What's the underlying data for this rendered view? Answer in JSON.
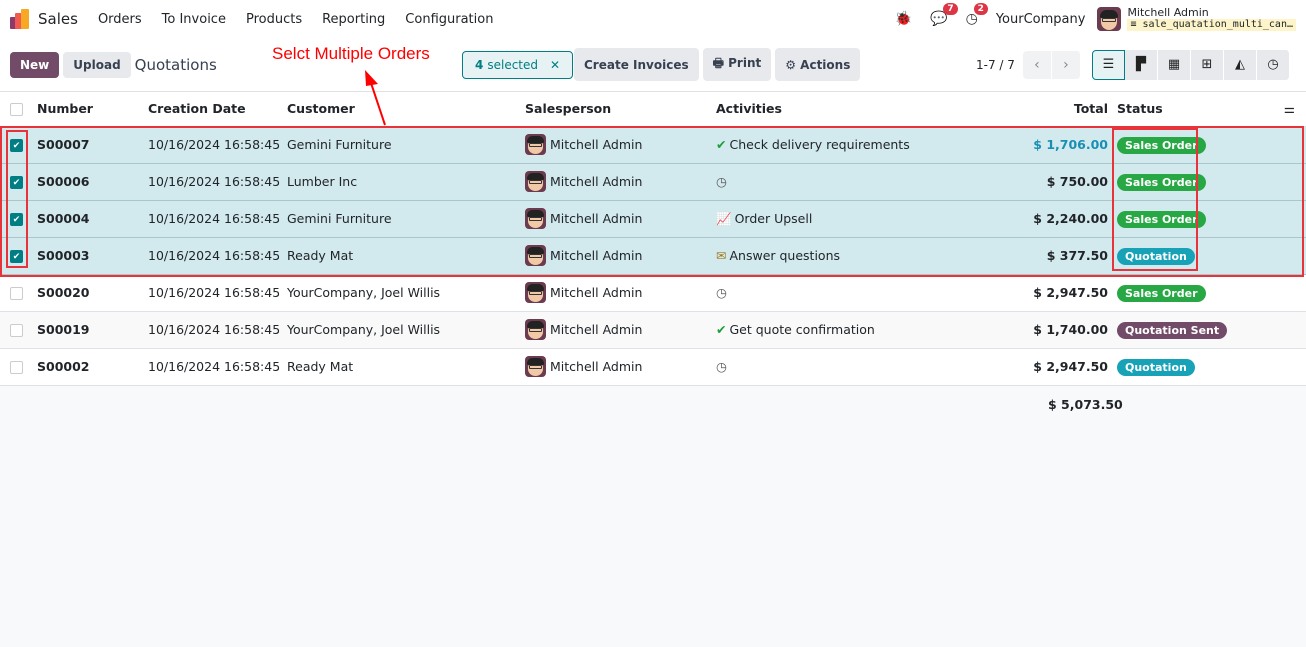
{
  "navbar": {
    "app_name": "Sales",
    "menu": [
      "Orders",
      "To Invoice",
      "Products",
      "Reporting",
      "Configuration"
    ],
    "messages_count": "7",
    "activities_count": "2",
    "company": "YourCompany",
    "user_name": "Mitchell Admin",
    "db_name": "sale_quatation_multi_can…"
  },
  "control": {
    "new_label": "New",
    "upload_label": "Upload",
    "breadcrumb": "Quotations",
    "selected_count": "4",
    "selected_label": "selected",
    "create_invoices_label": "Create Invoices",
    "print_label": "Print",
    "actions_label": "Actions",
    "pager": "1-7 / 7"
  },
  "annotation": "Selct Multiple Orders",
  "table": {
    "headers": {
      "number": "Number",
      "creation_date": "Creation Date",
      "customer": "Customer",
      "salesperson": "Salesperson",
      "activities": "Activities",
      "total": "Total",
      "status": "Status"
    },
    "rows": [
      {
        "number": "S00007",
        "date": "10/16/2024 16:58:45",
        "customer": "Gemini Furniture",
        "salesperson": "Mitchell Admin",
        "activity": "Check delivery requirements",
        "total": "$ 1,706.00",
        "status": "Sales Order"
      },
      {
        "number": "S00006",
        "date": "10/16/2024 16:58:45",
        "customer": "Lumber Inc",
        "salesperson": "Mitchell Admin",
        "activity": "",
        "total": "$ 750.00",
        "status": "Sales Order"
      },
      {
        "number": "S00004",
        "date": "10/16/2024 16:58:45",
        "customer": "Gemini Furniture",
        "salesperson": "Mitchell Admin",
        "activity": "Order Upsell",
        "total": "$ 2,240.00",
        "status": "Sales Order"
      },
      {
        "number": "S00003",
        "date": "10/16/2024 16:58:45",
        "customer": "Ready Mat",
        "salesperson": "Mitchell Admin",
        "activity": "Answer questions",
        "total": "$ 377.50",
        "status": "Quotation"
      },
      {
        "number": "S00020",
        "date": "10/16/2024 16:58:45",
        "customer": "YourCompany, Joel Willis",
        "salesperson": "Mitchell Admin",
        "activity": "",
        "total": "$ 2,947.50",
        "status": "Sales Order"
      },
      {
        "number": "S00019",
        "date": "10/16/2024 16:58:45",
        "customer": "YourCompany, Joel Willis",
        "salesperson": "Mitchell Admin",
        "activity": "Get quote confirmation",
        "total": "$ 1,740.00",
        "status": "Quotation Sent"
      },
      {
        "number": "S00002",
        "date": "10/16/2024 16:58:45",
        "customer": "Ready Mat",
        "salesperson": "Mitchell Admin",
        "activity": "",
        "total": "$ 2,947.50",
        "status": "Quotation"
      }
    ],
    "grand_total": "$ 5,073.50"
  },
  "colors": {
    "primary": "#714b67",
    "accent": "#017e84",
    "sales_order": "#28a745",
    "quotation": "#17a2b8",
    "quotation_sent": "#714b67",
    "annotation": "#ff0000"
  }
}
